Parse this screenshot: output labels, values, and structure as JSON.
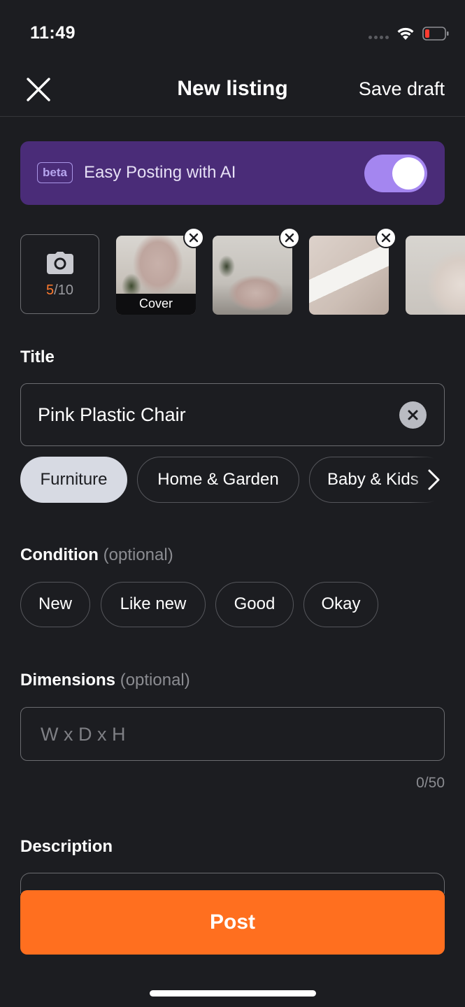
{
  "status_bar": {
    "time": "11:49"
  },
  "header": {
    "title": "New listing",
    "save_draft": "Save draft",
    "close_icon": "close-icon"
  },
  "ai_banner": {
    "badge": "beta",
    "label": "Easy Posting with AI",
    "toggle_on": true,
    "color": "#4a2c78"
  },
  "photos": {
    "count_current": "5",
    "count_max": "/10",
    "cover_label": "Cover",
    "items": [
      "chair-cover-photo",
      "chair-upside-down-photo",
      "chair-label-photo",
      "chair-side-photo"
    ]
  },
  "title_section": {
    "label": "Title",
    "value": "Pink Plastic Chair"
  },
  "categories": {
    "items": [
      {
        "label": "Furniture",
        "selected": true
      },
      {
        "label": "Home & Garden",
        "selected": false
      },
      {
        "label": "Baby & Kids",
        "selected": false
      }
    ]
  },
  "condition": {
    "label": "Condition",
    "optional": "(optional)",
    "options": [
      "New",
      "Like new",
      "Good",
      "Okay"
    ]
  },
  "dimensions": {
    "label": "Dimensions",
    "optional": "(optional)",
    "placeholder": "W x D x H",
    "value": "",
    "counter": "0/50"
  },
  "description": {
    "label": "Description"
  },
  "post_button": {
    "label": "Post",
    "color": "#ff6f1f"
  }
}
